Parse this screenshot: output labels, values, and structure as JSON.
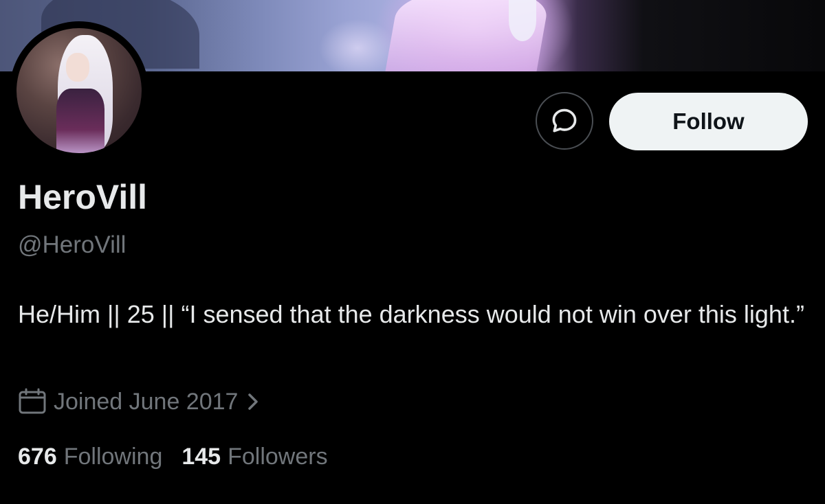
{
  "profile": {
    "display_name": "HeroVill",
    "handle": "@HeroVill",
    "bio": "He/Him || 25 || “I sensed that the darkness would not win over this light.”",
    "joined": "Joined June 2017"
  },
  "actions": {
    "follow_label": "Follow",
    "message_icon": "message-bubble-icon"
  },
  "stats": {
    "following_count": "676",
    "following_label": "Following",
    "followers_count": "145",
    "followers_label": "Followers"
  },
  "colors": {
    "background": "#000000",
    "primary_text": "#e7e9ea",
    "secondary_text": "#71767b",
    "follow_button_bg": "#eff3f4",
    "follow_button_text": "#0f1419"
  }
}
